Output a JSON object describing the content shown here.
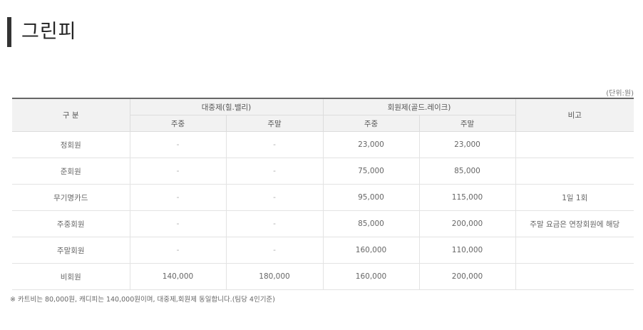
{
  "page": {
    "title": "그린피",
    "unit": "(단위:원)",
    "note": "※ 카트비는 80,000원, 캐디피는 140,000원이며, 대중제,회원제 동일합니다.(팀당 4인기준)"
  },
  "table": {
    "header_category": "구 분",
    "header_public": "대중제(힐.밸리)",
    "header_member": "회원제(골드.레이크)",
    "header_remark": "비고",
    "header_weekday_1": "주중",
    "header_weekend_1": "주말",
    "header_weekday_2": "주중",
    "header_weekend_2": "주말",
    "rows": [
      {
        "name": "정회원",
        "pub_weekday": "-",
        "pub_weekend": "-",
        "mem_weekday": "23,000",
        "mem_weekend": "23,000",
        "remark": ""
      },
      {
        "name": "준회원",
        "pub_weekday": "-",
        "pub_weekend": "-",
        "mem_weekday": "75,000",
        "mem_weekend": "85,000",
        "remark": ""
      },
      {
        "name": "무기명카드",
        "pub_weekday": "-",
        "pub_weekend": "-",
        "mem_weekday": "95,000",
        "mem_weekend": "115,000",
        "remark": "1일 1회"
      },
      {
        "name": "주중회원",
        "pub_weekday": "-",
        "pub_weekend": "-",
        "mem_weekday": "85,000",
        "mem_weekend": "200,000",
        "remark": "주말 요금은 연장회원에 해당"
      },
      {
        "name": "주말회원",
        "pub_weekday": "-",
        "pub_weekend": "-",
        "mem_weekday": "160,000",
        "mem_weekend": "110,000",
        "remark": ""
      },
      {
        "name": "비회원",
        "pub_weekday": "140,000",
        "pub_weekend": "180,000",
        "mem_weekday": "160,000",
        "mem_weekend": "200,000",
        "remark": ""
      }
    ]
  }
}
